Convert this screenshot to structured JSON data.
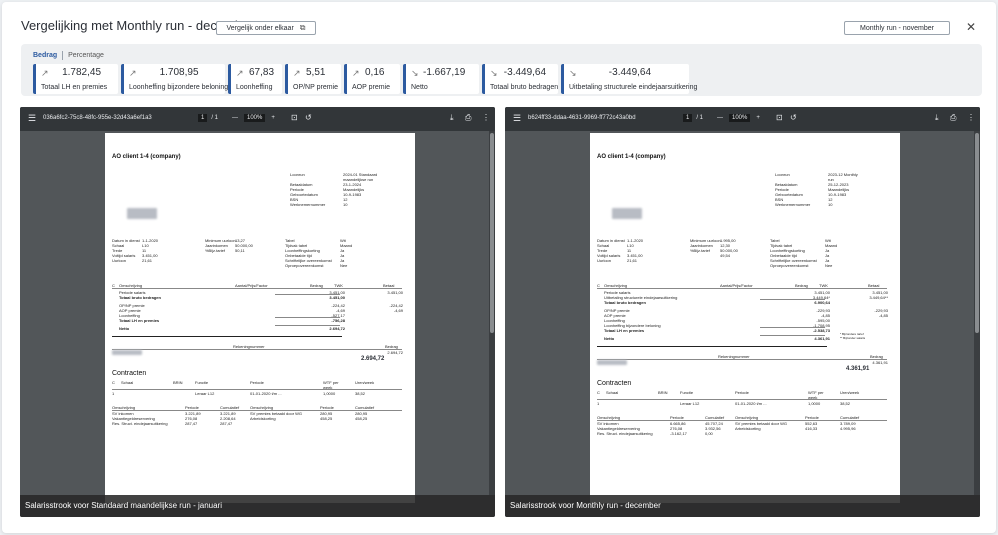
{
  "header": {
    "title": "Vergelijking met Monthly run - december",
    "compare_label": "Vergelijk onder elkaar",
    "run_select": "Monthly run - november"
  },
  "tabs": {
    "active": "Bedrag",
    "other": "Percentage"
  },
  "cards": [
    {
      "arrow": "↗",
      "value": "1.782,45",
      "label": "Totaal LH en premies"
    },
    {
      "arrow": "↗",
      "value": "1.708,95",
      "label": "Loonheffing bijzondere beloning"
    },
    {
      "arrow": "↗",
      "value": "67,83",
      "label": "Loonheffing"
    },
    {
      "arrow": "↗",
      "value": "5,51",
      "label": "OP/NP premie"
    },
    {
      "arrow": "↗",
      "value": "0,16",
      "label": "AOP premie"
    },
    {
      "arrow": "↘",
      "value": "-1.667,19",
      "label": "Netto"
    },
    {
      "arrow": "↘",
      "value": "-3.449,64",
      "label": "Totaal bruto bedragen"
    },
    {
      "arrow": "↘",
      "value": "-3.449,64",
      "label": "Uitbetaling structurele eindejaarsuitkering"
    }
  ],
  "left": {
    "filename": "036a6fc2-75c8-48fc-955e-32d43a6ef1a3",
    "page": "1",
    "pages": "/ 1",
    "zoom": "100%",
    "caption": "Salarisstrook voor Standaard maandelijkse run - januari",
    "doc": {
      "company": "AO client 1-4 (company)",
      "run_labels": [
        "Loonrun",
        "",
        "Betaaldatum",
        "Periode",
        "Geboortedatum",
        "BSN",
        "Werknemernummer"
      ],
      "run_values": [
        "2024-01 Standaard",
        "maandelijkse run",
        "23-1-2024",
        "Maandelijks",
        "10-9-1983",
        "12",
        "10"
      ],
      "col1_labels": [
        "Datum in dienst",
        "Schaal",
        "Trede",
        "Voltijd salaris",
        "Uurloon"
      ],
      "col1_values": [
        "1-1-2020",
        "L10",
        "11",
        "3.451,00",
        "21,61"
      ],
      "col2_labels": [
        "Minimum uurloon",
        "Jaarinkomen",
        "%Bijz.tarief"
      ],
      "col2_values": [
        "13,27",
        "50.000,00",
        "50,11"
      ],
      "col3_labels": [
        "Tabel",
        "Tijdvak tabel",
        "Loonheffingskorting",
        "Onbetaalde tijd",
        "Schriftelijke overeenkomst",
        "Oproepovereenkomst"
      ],
      "col3_values": [
        "Wit",
        "Maand",
        "Ja",
        "Ja",
        "Ja",
        "Nee"
      ],
      "table_head": [
        "C",
        "Omschrijving",
        "Aantal/Prijs/Factor",
        "Bedrag",
        "TWK",
        "Betaal"
      ],
      "rows": [
        {
          "c": "",
          "desc": "Periode salaris",
          "amount": "3.451,00",
          "betaal": "3.451,00",
          "bold": false
        },
        {
          "c": "",
          "desc": "Totaal bruto bedragen",
          "amount": "3.451,00",
          "betaal": "",
          "bold": true
        },
        {
          "c": "",
          "desc": "OP/NP premie",
          "amount": "-224,42",
          "betaal": "-224,42",
          "bold": false
        },
        {
          "c": "",
          "desc": "AOP premie",
          "amount": "-4,69",
          "betaal": "-4,69",
          "bold": false
        },
        {
          "c": "",
          "desc": "Loonheffing",
          "amount": "-527,17",
          "betaal": "",
          "bold": false
        },
        {
          "c": "",
          "desc": "Totaal LH en premies",
          "amount": "-756,28",
          "betaal": "",
          "bold": true
        },
        {
          "c": "",
          "desc": "Netto",
          "amount": "2.694,72",
          "betaal": "",
          "bold": true
        }
      ],
      "bank_head": [
        "",
        "Rekeningnummer",
        "Bedrag"
      ],
      "bank_amount": "2.694,72",
      "bank_total": "2.694,72",
      "contracts_title": "Contracten",
      "contract_head": [
        "C",
        "Schaal",
        "BRIN",
        "Functie",
        "Periode",
        "WTF per week",
        "Uren/week"
      ],
      "contract_row": [
        "1",
        "",
        "",
        "Leraar L12",
        "01-01-2020 t/m ...",
        "1,0000",
        "38,52"
      ],
      "cum_head": [
        "Omschrijving",
        "Periode",
        "Cumulatief",
        "Omschrijving",
        "Periode",
        "Cumulatief"
      ],
      "cum_rows": [
        [
          "SV inkomen",
          "3.221,89",
          "3.221,89",
          "SV premies betaald door WG",
          "280,95",
          "280,95"
        ],
        [
          "Vakantiegeldreservering",
          "276,08",
          "2.208,64",
          "Arbeidskorting",
          "458,25",
          "458,25"
        ],
        [
          "Res. Struct. eindejaarsuitkering",
          "287,47",
          "287,47",
          "",
          "",
          ""
        ]
      ]
    }
  },
  "right": {
    "filename": "b624ff33-ddaa-4631-9969-ff772c43a0bd",
    "page": "1",
    "pages": "/ 1",
    "zoom": "100%",
    "caption": "Salarisstrook voor Monthly run - december",
    "doc": {
      "company": "AO client 1-4 (company)",
      "run_labels": [
        "Loonrun",
        "",
        "Betaaldatum",
        "Periode",
        "Geboortedatum",
        "BSN",
        "Werknemernummer"
      ],
      "run_values": [
        "2023-12 Monthly",
        "run",
        "25-12-2023",
        "Maandelijks",
        "10-9-1983",
        "12",
        "10"
      ],
      "col1_labels": [
        "Datum in dienst",
        "Schaal",
        "Trede",
        "Voltijd salaris",
        "Uurloon"
      ],
      "col1_values": [
        "1-1-2020",
        "L10",
        "11",
        "3.451,00",
        "21,61"
      ],
      "col2_labels": [
        "Minimum uurloon",
        "Jaarinkomen",
        "%Bijz.tarief"
      ],
      "col2_values": [
        "1.995,00",
        "12,30",
        "50.000,00",
        "49,54"
      ],
      "col3_labels": [
        "Tabel",
        "Tijdvak tabel",
        "Loonheffingskorting",
        "Onbetaalde tijd",
        "Schriftelijke overeenkomst",
        "Oproepovereenkomst"
      ],
      "col3_values": [
        "Wit",
        "Maand",
        "Ja",
        "Ja",
        "Ja",
        "Nee"
      ],
      "table_head": [
        "C",
        "Omschrijving",
        "Aantal/Prijs/Factor",
        "Bedrag",
        "TWK",
        "Betaal"
      ],
      "rows": [
        {
          "c": "",
          "desc": "Periode salaris",
          "amount": "3.451,00",
          "betaal": "3.451,00",
          "bold": false
        },
        {
          "c": "",
          "desc": "Uitbetaling structurele eindejaarsuitkering",
          "amount": "3.449,64*",
          "betaal": "3.449,64**",
          "bold": false
        },
        {
          "c": "",
          "desc": "Totaal bruto bedragen",
          "amount": "6.900,64",
          "betaal": "",
          "bold": true
        },
        {
          "c": "",
          "desc": "OP/NP premie",
          "amount": "-229,93",
          "betaal": "-229,93",
          "bold": false
        },
        {
          "c": "",
          "desc": "AOP premie",
          "amount": "-4,85",
          "betaal": "-4,85",
          "bold": false
        },
        {
          "c": "",
          "desc": "Loonheffing",
          "amount": "-595,00",
          "betaal": "",
          "bold": false
        },
        {
          "c": "",
          "desc": "Loonheffing bijzondere beloning",
          "amount": "-1.708,95",
          "betaal": "",
          "bold": false
        },
        {
          "c": "",
          "desc": "Totaal LH en premies",
          "amount": "-2.538,73",
          "betaal": "",
          "bold": true
        },
        {
          "c": "",
          "desc": "Netto",
          "amount": "4.361,91",
          "betaal": "",
          "bold": true
        }
      ],
      "footnote": "* Bijzondere tarief\n** Bijzonder salaris",
      "bank_head": [
        "",
        "Rekeningnummer",
        "Bedrag"
      ],
      "bank_amount": "4.361,91",
      "bank_total": "4.361,91",
      "contracts_title": "Contracten",
      "contract_head": [
        "C",
        "Schaal",
        "BRIN",
        "Functie",
        "Periode",
        "WTF per week",
        "Uren/week"
      ],
      "contract_row": [
        "1",
        "",
        "",
        "Leraar L12",
        "01-01-2020 t/m ...",
        "1,0000",
        "38,52"
      ],
      "cum_head": [
        "Omschrijving",
        "Periode",
        "Cumulatief",
        "Omschrijving",
        "Periode",
        "Cumulatief"
      ],
      "cum_rows": [
        [
          "SV inkomen",
          "6.665,86",
          "45.707,24",
          "SV premies betaald door WG",
          "552,63",
          "3.789,09"
        ],
        [
          "Vakantiegeldreservering",
          "276,08",
          "3.932,56",
          "Arbeidskorting",
          "416,33",
          "4.995,96"
        ],
        [
          "Res. Struct. eindejaarsuitkering",
          "-3.162,17",
          "0,00",
          "",
          "",
          ""
        ]
      ]
    }
  }
}
